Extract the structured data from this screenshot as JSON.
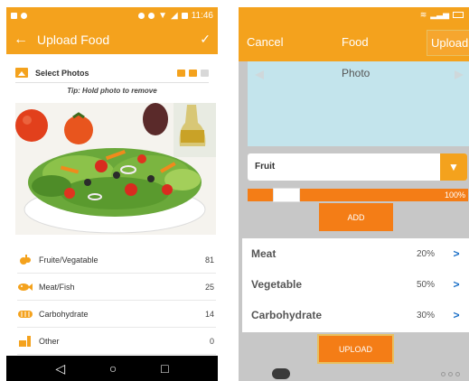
{
  "left": {
    "status": {
      "time": "11:46"
    },
    "appbar": {
      "back_glyph": "←",
      "title": "Upload Food",
      "done_glyph": "✓"
    },
    "select_photos": {
      "label": "Select Photos",
      "icon": "image-icon"
    },
    "tip": "Tip: Hold photo to remove",
    "categories": [
      {
        "label": "Fruite/Vegatable",
        "count": "81",
        "icon": "fruit-vegetable-icon"
      },
      {
        "label": "Meat/Fish",
        "count": "25",
        "icon": "fish-icon"
      },
      {
        "label": "Carbohydrate",
        "count": "14",
        "icon": "bread-icon"
      },
      {
        "label": "Other",
        "count": "0",
        "icon": "drink-icon"
      }
    ],
    "nav": {
      "back": "◁",
      "home": "○",
      "recents": "□"
    }
  },
  "right": {
    "topbar": {
      "cancel": "Cancel",
      "title": "Food",
      "upload": "Upload"
    },
    "photo_label": "Photo",
    "dropdown": {
      "value": "Fruit",
      "arrow": "▼"
    },
    "progress": {
      "value": 100,
      "label": "100%"
    },
    "add_label": "ADD",
    "items": [
      {
        "name": "Meat",
        "percent": "20%"
      },
      {
        "name": "Vegetable",
        "percent": "50%"
      },
      {
        "name": "Carbohydrate",
        "percent": "30%"
      }
    ],
    "upload_label": "UPLOAD"
  },
  "colors": {
    "accent": "#f4a21d",
    "accent_dark": "#f47d16",
    "link": "#1a6fc7",
    "photo_bg": "#c3e4ec"
  }
}
